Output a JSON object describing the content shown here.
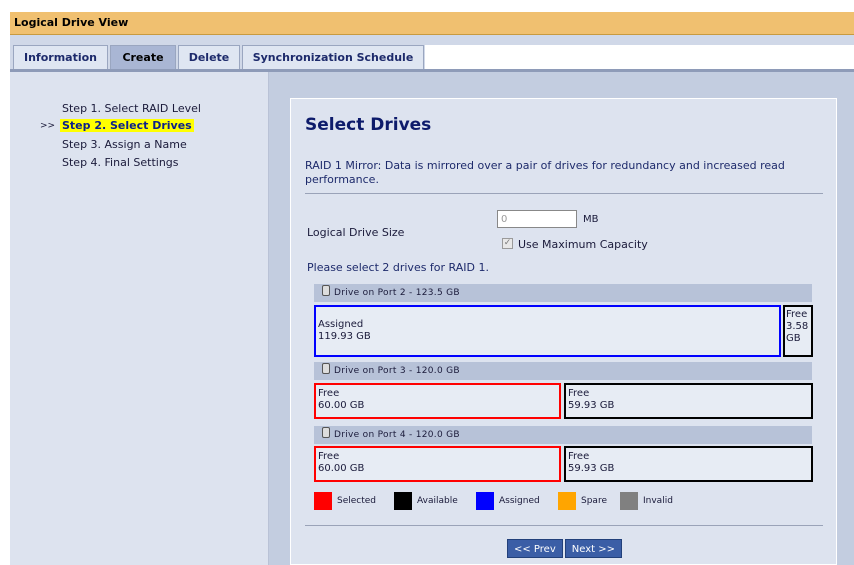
{
  "window": {
    "title": "Logical Drive View"
  },
  "tabs": [
    {
      "label": "Information"
    },
    {
      "label": "Create"
    },
    {
      "label": "Delete"
    },
    {
      "label": "Synchronization Schedule"
    }
  ],
  "steps": [
    {
      "label": "Step 1. Select RAID Level"
    },
    {
      "label": "Step 2. Select Drives"
    },
    {
      "label": "Step 3. Assign a Name"
    },
    {
      "label": "Step 4. Final Settings"
    }
  ],
  "current_step_marker": ">>",
  "main": {
    "heading": "Select Drives",
    "description": "RAID 1 Mirror: Data is mirrored over a pair of drives for redundancy and increased read performance.",
    "size_label": "Logical Drive Size",
    "size_value": "0",
    "size_unit": "MB",
    "use_max_label": "Use Maximum Capacity",
    "use_max_checked": true,
    "select_prompt": "Please select 2 drives for RAID 1.",
    "drives": [
      {
        "header": "Drive on Port 2 - 123.5 GB",
        "segments": [
          {
            "line1": "Assigned",
            "line2": "119.93 GB",
            "status": "assigned"
          },
          {
            "line1": "Free",
            "line2": "3.58",
            "line3": "GB",
            "status": "available"
          }
        ]
      },
      {
        "header": "Drive on Port 3 - 120.0 GB",
        "segments": [
          {
            "line1": "Free",
            "line2": "60.00 GB",
            "status": "selected"
          },
          {
            "line1": "Free",
            "line2": "59.93 GB",
            "status": "available"
          }
        ]
      },
      {
        "header": "Drive on Port 4 - 120.0 GB",
        "segments": [
          {
            "line1": "Free",
            "line2": "60.00 GB",
            "status": "selected"
          },
          {
            "line1": "Free",
            "line2": "59.93 GB",
            "status": "available"
          }
        ]
      }
    ],
    "legend": [
      {
        "label": "Selected",
        "color": "#ff0000"
      },
      {
        "label": "Available",
        "color": "#000000"
      },
      {
        "label": "Assigned",
        "color": "#0000ff"
      },
      {
        "label": "Spare",
        "color": "#ffa500"
      },
      {
        "label": "Invalid",
        "color": "#808080"
      }
    ],
    "prev_label": "<< Prev",
    "next_label": "Next >>"
  },
  "colors": {
    "title_bar": "#f0c070",
    "panel": "#dde3ef",
    "heading": "#0d1b6b",
    "button": "#3b5ea6",
    "highlight": "#ffff00"
  }
}
